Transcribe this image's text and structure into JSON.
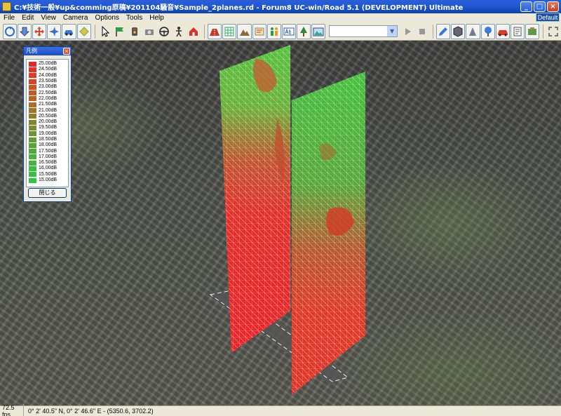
{
  "window": {
    "title": "C:¥技術一般¥up&comming原稿¥201104騒音¥Sample_2planes.rd - Forum8 UC-win/Road 5.1 (DEVELOPMENT) Ultimate",
    "minimize": "_",
    "maximize": "□",
    "close": "×",
    "default_badge": "Default"
  },
  "menu": [
    "File",
    "Edit",
    "View",
    "Camera",
    "Options",
    "Tools",
    "Help"
  ],
  "legend": {
    "title": "凡例",
    "close_button": "閉じる",
    "entries": [
      {
        "label": "25.00dB",
        "color": "#e8262a"
      },
      {
        "label": "24.50dB",
        "color": "#e52f28"
      },
      {
        "label": "24.00dB",
        "color": "#e13a26"
      },
      {
        "label": "23.50dB",
        "color": "#d94524"
      },
      {
        "label": "23.00dB",
        "color": "#cf5022"
      },
      {
        "label": "22.50dB",
        "color": "#c55b22"
      },
      {
        "label": "22.00dB",
        "color": "#b96424"
      },
      {
        "label": "21.50dB",
        "color": "#ac6c27"
      },
      {
        "label": "21.00dB",
        "color": "#9e742a"
      },
      {
        "label": "20.50dB",
        "color": "#917c2d"
      },
      {
        "label": "20.00dB",
        "color": "#838430"
      },
      {
        "label": "19.50dB",
        "color": "#788c32"
      },
      {
        "label": "19.00dB",
        "color": "#6c9434"
      },
      {
        "label": "18.50dB",
        "color": "#629c36"
      },
      {
        "label": "18.00dB",
        "color": "#58a338"
      },
      {
        "label": "17.50dB",
        "color": "#4faa3a"
      },
      {
        "label": "17.00dB",
        "color": "#47b13b"
      },
      {
        "label": "16.50dB",
        "color": "#40b73c"
      },
      {
        "label": "16.00dB",
        "color": "#39bd3d"
      },
      {
        "label": "15.50dB",
        "color": "#33c23e"
      },
      {
        "label": "15.00dB",
        "color": "#2ec73f"
      }
    ]
  },
  "status": {
    "fps": "72.5 fps",
    "coordinates": "0°  2' 40.5\" N, 0°  2' 46.6\" E  -  (5350.6, 3702.2)"
  },
  "colors": {
    "titlebar": "#0a3fae",
    "chrome": "#ece9d8",
    "noise_high": "#e8262a",
    "noise_low": "#2ec73f"
  }
}
